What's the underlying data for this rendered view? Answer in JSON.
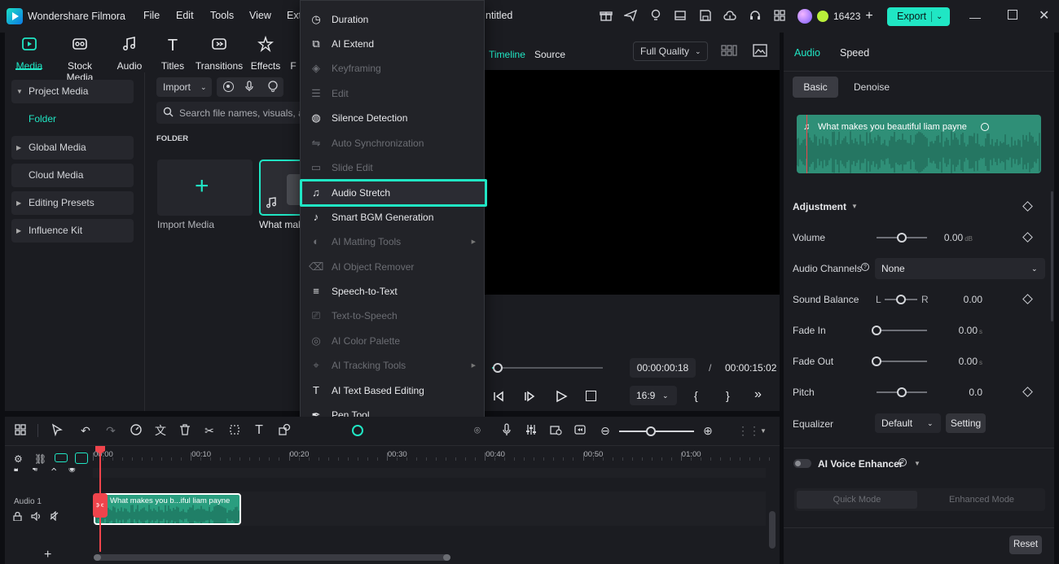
{
  "app": {
    "title": "Wondershare Filmora",
    "project_title_partial": "ntitled",
    "menu": [
      "File",
      "Edit",
      "Tools",
      "View",
      "Ext"
    ],
    "credits": "16423",
    "export_label": "Export"
  },
  "toolbar": {
    "tabs": [
      {
        "label": "Media",
        "icon": "media-icon"
      },
      {
        "label": "Stock Media",
        "icon": "stock-media-icon"
      },
      {
        "label": "Audio",
        "icon": "audio-icon"
      },
      {
        "label": "Titles",
        "icon": "titles-icon"
      },
      {
        "label": "Transitions",
        "icon": "transitions-icon"
      },
      {
        "label": "Effects",
        "icon": "effects-icon"
      },
      {
        "label": "F",
        "icon": "filters-icon"
      }
    ]
  },
  "sidebar": {
    "items": [
      "Project Media",
      "Folder",
      "Global Media",
      "Cloud Media",
      "Editing Presets",
      "Influence Kit"
    ]
  },
  "media": {
    "import_label": "Import",
    "search_placeholder": "Search file names, visuals, and",
    "folder_heading": "FOLDER",
    "import_media_label": "Import Media",
    "clip_label": "What mak"
  },
  "preview": {
    "timeline_tab": "Timeline",
    "source_tab": "Source",
    "quality": "Full Quality",
    "current_time": "00:00:00:18",
    "separator": "/",
    "total_time": "00:00:15:02",
    "aspect": "16:9",
    "playback_progress": 0.05
  },
  "context_menu": {
    "items": [
      {
        "label": "Duration",
        "enabled": true,
        "icon": "clock-icon",
        "arrow": false
      },
      {
        "label": "AI Extend",
        "enabled": true,
        "icon": "ai-extend-icon",
        "arrow": false
      },
      {
        "label": "Keyframing",
        "enabled": false,
        "icon": "keyframe-icon",
        "arrow": false
      },
      {
        "label": "Edit",
        "enabled": false,
        "icon": "edit-sliders-icon",
        "arrow": false
      },
      {
        "label": "Silence Detection",
        "enabled": true,
        "icon": "silence-detection-icon",
        "arrow": false
      },
      {
        "label": "Auto Synchronization",
        "enabled": false,
        "icon": "auto-sync-icon",
        "arrow": false
      },
      {
        "label": "Slide Edit",
        "enabled": false,
        "icon": "slide-edit-icon",
        "arrow": false
      },
      {
        "label": "Audio Stretch",
        "enabled": true,
        "icon": "audio-stretch-icon",
        "arrow": false,
        "highlighted": true
      },
      {
        "label": "Smart BGM Generation",
        "enabled": true,
        "icon": "smart-bgm-icon",
        "arrow": false
      },
      {
        "label": "AI Matting Tools",
        "enabled": false,
        "icon": "ai-matting-icon",
        "arrow": true
      },
      {
        "label": "AI Object Remover",
        "enabled": false,
        "icon": "object-remover-icon",
        "arrow": false
      },
      {
        "label": "Speech-to-Text",
        "enabled": true,
        "icon": "speech-to-text-icon",
        "arrow": false
      },
      {
        "label": "Text-to-Speech",
        "enabled": false,
        "icon": "text-to-speech-icon",
        "arrow": false
      },
      {
        "label": "AI Color Palette",
        "enabled": false,
        "icon": "color-palette-icon",
        "arrow": false
      },
      {
        "label": "AI Tracking Tools",
        "enabled": false,
        "icon": "ai-tracking-icon",
        "arrow": true
      },
      {
        "label": "AI Text Based Editing",
        "enabled": true,
        "icon": "text-based-editing-icon",
        "arrow": false
      },
      {
        "label": "Pen Tool",
        "enabled": true,
        "icon": "pen-tool-icon",
        "arrow": false
      }
    ]
  },
  "properties": {
    "tabs": [
      "Audio",
      "Speed"
    ],
    "subtabs": [
      "Basic",
      "Denoise"
    ],
    "audio_title": "What makes you beautiful  liam payne",
    "adjustment_label": "Adjustment",
    "volume": {
      "label": "Volume",
      "value": "0.00",
      "unit": "dB",
      "level": 0.5
    },
    "audio_channels": {
      "label": "Audio Channels",
      "value": "None"
    },
    "sound_balance": {
      "label": "Sound Balance",
      "left": "L",
      "right": "R",
      "value": "0.00",
      "level": 0.5
    },
    "fade_in": {
      "label": "Fade In",
      "value": "0.00",
      "unit": "s",
      "level": 0
    },
    "fade_out": {
      "label": "Fade Out",
      "value": "0.00",
      "unit": "s",
      "level": 0
    },
    "pitch": {
      "label": "Pitch",
      "value": "0.0",
      "level": 0.5
    },
    "equalizer": {
      "label": "Equalizer",
      "value": "Default",
      "setting": "Setting"
    },
    "ai_voice_enhancer": "AI Voice Enhancer",
    "quick_mode": "Quick Mode",
    "enhanced_mode": "Enhanced Mode",
    "reset": "Reset"
  },
  "timeline": {
    "ruler": [
      "00:00",
      "00:10",
      "00:20",
      "00:30",
      "00:40",
      "00:50",
      "01:00"
    ],
    "track_label": "Audio 1",
    "clip_label": "What makes you b...iful  liam payne",
    "colors": {
      "accent": "#20e6c4",
      "clip": "#2a9e7f",
      "playhead": "#f0444c"
    }
  }
}
